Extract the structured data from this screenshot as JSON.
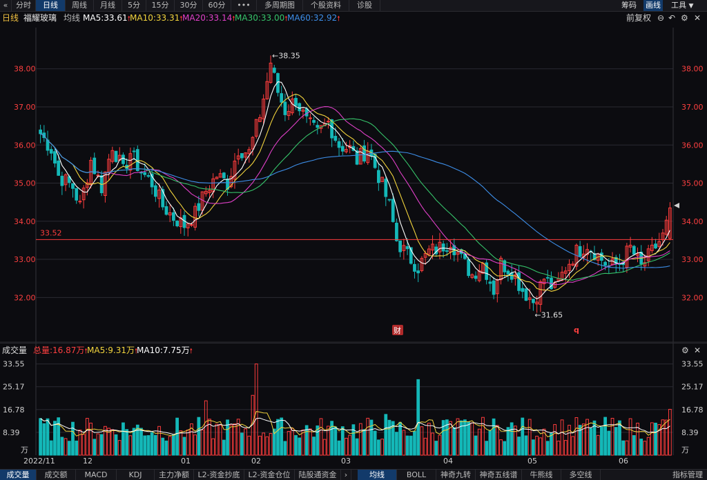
{
  "toolbar": {
    "back_icon": "double-chevron-left-icon",
    "tabs": [
      "分时",
      "日线",
      "周线",
      "月线",
      "5分",
      "15分",
      "30分",
      "60分",
      "•••",
      "多周期图",
      "个股资料",
      "诊股"
    ],
    "active_tab": "日线",
    "right": [
      "筹码",
      "画线",
      "工具"
    ],
    "right_active": "画线"
  },
  "legend": {
    "period": "日线",
    "stock_name": "福耀玻璃",
    "ma_label": "均线",
    "ma5": "MA5:33.61",
    "ma10": "MA10:33.31",
    "ma20": "MA20:33.14",
    "ma30": "MA30:33.00",
    "ma60": "MA60:32.92",
    "adjust": "前复权"
  },
  "colors": {
    "up": "#ff3d3d",
    "down": "#14b8b8",
    "ma5": "#ffffff",
    "ma10": "#f2d43d",
    "ma20": "#e040c8",
    "ma30": "#36c46a",
    "ma60": "#3d8ee8",
    "hline": "#ff3d3d",
    "grid": "#2a2a32",
    "axis_text_price": "#ff4040",
    "axis_text_vol": "#cfcfcf"
  },
  "price_axis": {
    "ticks": [
      "38.00",
      "37.00",
      "36.00",
      "35.00",
      "34.00",
      "33.00",
      "32.00"
    ],
    "values": [
      38,
      37,
      36,
      35,
      34,
      33,
      32
    ],
    "ylim": [
      31.3,
      38.9
    ]
  },
  "annotations": {
    "high_label": "38.35",
    "low_label": "31.65",
    "hline_label": "33.52",
    "hline_value": 33.52,
    "cai_badge": "财",
    "q_mark": "q"
  },
  "volume_legend": {
    "title": "成交量",
    "total": "总量:16.87万",
    "ma5": "MA5:9.31万",
    "ma10": "MA10:7.75万"
  },
  "volume_axis": {
    "ticks": [
      "33.55",
      "25.17",
      "16.78",
      "8.39"
    ],
    "values": [
      33.55,
      25.17,
      16.78,
      8.39
    ],
    "unit": "万",
    "ylim": [
      0,
      35.5
    ]
  },
  "x_axis": {
    "labels": [
      "2022/11",
      "12",
      "01",
      "02",
      "03",
      "04",
      "05",
      "06"
    ]
  },
  "bottom_tabs": [
    "成交量",
    "成交额",
    "MACD",
    "KDJ",
    "主力净额",
    "L2-资金抄底",
    "L2-资金仓位",
    "陆股通资金",
    "›",
    "均线",
    "BOLL",
    "神奇九转",
    "神奇五线谱",
    "牛熊线",
    "多空线",
    "指标管理"
  ],
  "bottom_active": [
    "成交量",
    "均线"
  ],
  "chart_data": {
    "type": "candlestick",
    "x_labels": [
      "2022/11",
      "12",
      "01",
      "02",
      "03",
      "04",
      "05",
      "06"
    ],
    "summary": {
      "period_high": 38.35,
      "period_low": 31.65,
      "reference_line": 33.52,
      "last_total_volume_wan": 16.87
    },
    "ma_latest": {
      "MA5": 33.61,
      "MA10": 33.31,
      "MA20": 33.14,
      "MA30": 33.0,
      "MA60": 32.92
    },
    "anchors": [
      [
        0,
        36.3
      ],
      [
        3,
        35.9
      ],
      [
        5,
        35.2
      ],
      [
        9,
        34.9
      ],
      [
        11,
        34.4
      ],
      [
        14,
        35.6
      ],
      [
        17,
        34.9
      ],
      [
        20,
        36.0
      ],
      [
        23,
        35.3
      ],
      [
        25,
        35.8
      ],
      [
        28,
        35.3
      ],
      [
        31,
        35.0
      ],
      [
        34,
        34.4
      ],
      [
        37,
        34.1
      ],
      [
        40,
        33.9
      ],
      [
        43,
        34.2
      ],
      [
        46,
        34.8
      ],
      [
        49,
        35.2
      ],
      [
        52,
        35.0
      ],
      [
        55,
        35.9
      ],
      [
        58,
        35.8
      ],
      [
        61,
        36.8
      ],
      [
        64,
        38.1
      ],
      [
        66,
        37.4
      ],
      [
        68,
        36.9
      ],
      [
        71,
        37.2
      ],
      [
        74,
        36.6
      ],
      [
        77,
        36.3
      ],
      [
        80,
        36.6
      ],
      [
        83,
        36.0
      ],
      [
        86,
        35.9
      ],
      [
        88,
        35.6
      ],
      [
        91,
        35.9
      ],
      [
        94,
        35.2
      ],
      [
        97,
        34.4
      ],
      [
        99,
        33.5
      ],
      [
        102,
        33.1
      ],
      [
        105,
        32.8
      ],
      [
        108,
        33.2
      ],
      [
        111,
        33.3
      ],
      [
        114,
        33.5
      ],
      [
        117,
        33.0
      ],
      [
        120,
        32.6
      ],
      [
        123,
        32.9
      ],
      [
        126,
        32.2
      ],
      [
        128,
        32.9
      ],
      [
        131,
        32.7
      ],
      [
        134,
        32.2
      ],
      [
        137,
        31.9
      ],
      [
        140,
        32.5
      ],
      [
        143,
        32.2
      ],
      [
        146,
        32.8
      ],
      [
        149,
        33.2
      ],
      [
        152,
        33.4
      ],
      [
        155,
        33.1
      ],
      [
        158,
        32.8
      ],
      [
        161,
        32.9
      ],
      [
        164,
        33.3
      ],
      [
        167,
        32.8
      ],
      [
        170,
        33.2
      ],
      [
        173,
        33.6
      ],
      [
        175,
        34.2
      ]
    ],
    "count": 176
  }
}
